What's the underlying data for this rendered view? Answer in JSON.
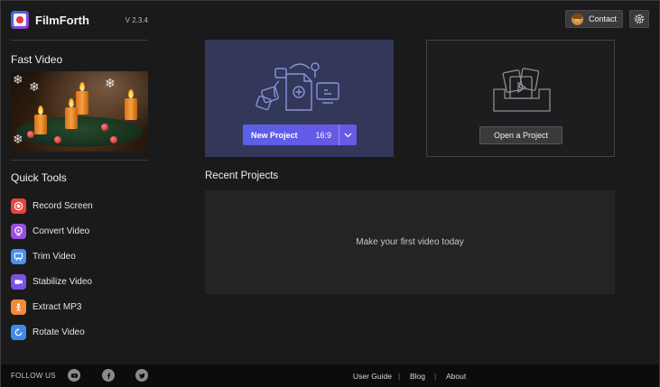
{
  "app": {
    "name": "FilmForth",
    "version": "V 2.3.4"
  },
  "sidebar": {
    "fast_video_title": "Fast Video",
    "quick_tools_title": "Quick Tools",
    "tools": [
      {
        "label": "Record Screen",
        "icon": "record-icon",
        "color": "#e8443f"
      },
      {
        "label": "Convert Video",
        "icon": "convert-icon",
        "color": "#9b4fe0"
      },
      {
        "label": "Trim Video",
        "icon": "trim-icon",
        "color": "#4c8ff0"
      },
      {
        "label": "Stabilize Video",
        "icon": "stabilize-icon",
        "color": "#7b52e8"
      },
      {
        "label": "Extract MP3",
        "icon": "extract-mp3-icon",
        "color": "#f08a3c"
      },
      {
        "label": "Rotate Video",
        "icon": "rotate-icon",
        "color": "#3f8ce8"
      }
    ]
  },
  "header": {
    "contact_label": "Contact"
  },
  "main": {
    "new_project_label": "New Project",
    "new_project_ratio": "16:9",
    "open_project_label": "Open a Project",
    "recent_title": "Recent Projects",
    "recent_empty": "Make your first video today"
  },
  "footer": {
    "follow_label": "FOLLOW US",
    "links": [
      "User Guide",
      "Blog",
      "About"
    ],
    "separator": "|"
  },
  "colors": {
    "accent": "#5b5fe8",
    "new_card": "#33375a",
    "background": "#1a1a1b"
  }
}
